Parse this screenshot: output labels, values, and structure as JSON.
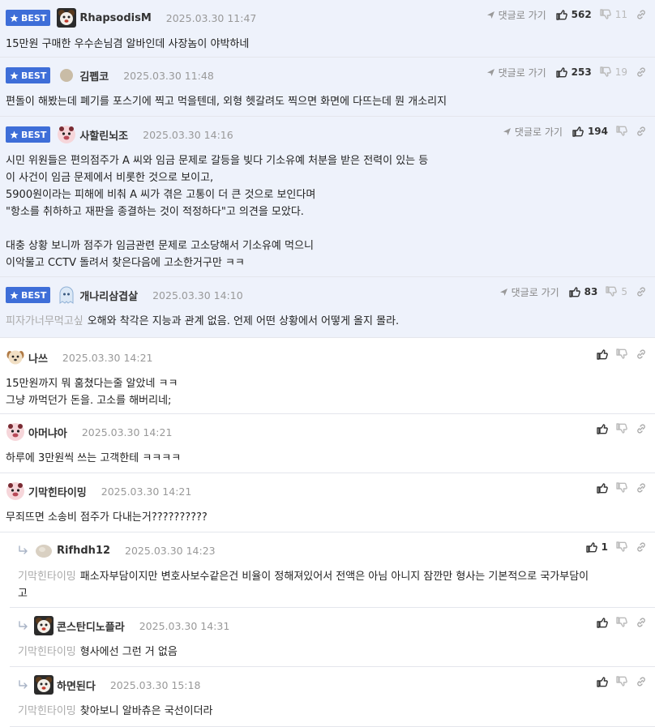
{
  "ui": {
    "best_label": "BEST",
    "reply_label": "댓글로 가기"
  },
  "colors": {
    "best_badge": "#3e6ed8",
    "best_bg": "#eef2fb",
    "mention": "#aaaaaa"
  },
  "comments": [
    {
      "best": true,
      "avatar": "bear-avatar-icon",
      "nick": "RhapsodisM",
      "date": "2025.03.30 11:47",
      "up": "562",
      "down": "11",
      "lines": "15만원 구매한 우수손님겸 알바인데 사장놈이 야박하네"
    },
    {
      "best": true,
      "avatar": "default-avatar-icon",
      "nick": "김펩코",
      "date": "2025.03.30 11:48",
      "up": "253",
      "down": "19",
      "lines": "편돌이 해봤는데 폐기를 포스기에 찍고 먹을텐데, 외형 헷갈려도 찍으면 화면에 다뜨는데 뭔 개소리지"
    },
    {
      "best": true,
      "avatar": "pig-avatar-icon",
      "nick": "사할린뇌조",
      "date": "2025.03.30 14:16",
      "up": "194",
      "down": "",
      "lines": "시민 위원들은 편의점주가 A 씨와 임금 문제로 갈등을 빚다 기소유예 처분을 받은 전력이 있는 등\n이 사건이 임금 문제에서 비롯한 것으로 보이고,\n5900원이라는 피해에 비춰 A 씨가 겪은 고통이 더 큰 것으로 보인다며\n\"항소를 취하하고 재판을 종결하는 것이 적정하다\"고 의견을 모았다.\n\n대충 상황 보니까 점주가 임금관련 문제로 고소당해서 기소유예 먹으니\n이악물고 CCTV 돌려서 찾은다음에 고소한거구만 ㅋㅋ"
    },
    {
      "best": true,
      "avatar": "ghost-avatar-icon",
      "nick": "개나리삼겹살",
      "date": "2025.03.30 14:10",
      "up": "83",
      "down": "5",
      "mention": "피자가너무먹고싶",
      "lines": "오해와 착각은 지능과 관계 없음. 언제 어떤 상황에서 어떻게 올지 몰라."
    },
    {
      "best": false,
      "avatar": "puppy-avatar-icon",
      "nick": "나쓰",
      "date": "2025.03.30 14:21",
      "up": "",
      "down": "",
      "lines": "15만원까지 뭐 훔쳤다는줄 알았네 ㅋㅋ\n그냥 까먹던가 돈을. 고소를 해버리네;"
    },
    {
      "best": false,
      "avatar": "pig-avatar-icon",
      "nick": "아머냐아",
      "date": "2025.03.30 14:21",
      "up": "",
      "down": "",
      "lines": "하루에 3만원씩 쓰는 고객한테 ㅋㅋㅋㅋ"
    },
    {
      "best": false,
      "avatar": "pig-avatar-icon",
      "nick": "기막힌타이밍",
      "date": "2025.03.30 14:21",
      "up": "",
      "down": "",
      "lines": "무죄뜨면 소송비 점주가 다내는거??????????"
    },
    {
      "best": false,
      "reply": true,
      "avatar": "rock-avatar-icon",
      "nick": "Rifhdh12",
      "date": "2025.03.30 14:23",
      "up": "1",
      "down": "",
      "mention": "기막힌타이밍",
      "lines": "패소자부담이지만 변호사보수같은건 비율이 정해져있어서 전액은 아님 아니지 잠깐만 형사는 기본적으로 국가부담이\n고"
    },
    {
      "best": false,
      "reply": true,
      "avatar": "bear-avatar-icon",
      "nick": "콘스탄디노플라",
      "date": "2025.03.30 14:31",
      "up": "",
      "down": "",
      "mention": "기막힌타이밍",
      "lines": "형사에선 그런 거 없음"
    },
    {
      "best": false,
      "reply": true,
      "avatar": "bear-avatar-icon",
      "nick": "하면된다",
      "date": "2025.03.30 15:18",
      "up": "",
      "down": "",
      "mention": "기막힌타이밍",
      "lines": "찾아보니 알바츄은 국선이더라"
    }
  ]
}
